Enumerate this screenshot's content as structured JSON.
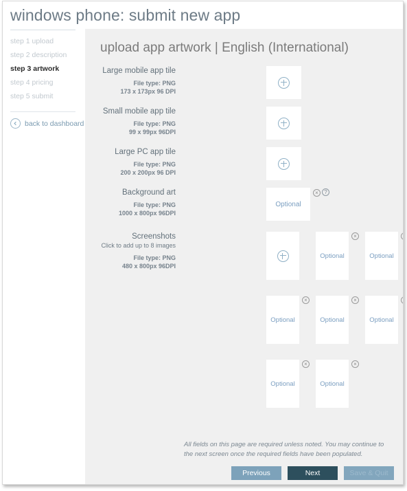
{
  "window": {
    "title": "windows phone: submit new app"
  },
  "sidebar": {
    "steps": [
      {
        "label": "step 1 upload",
        "active": false
      },
      {
        "label": "step 2 description",
        "active": false
      },
      {
        "label": "step 3 artwork",
        "active": true
      },
      {
        "label": "step 4 pricing",
        "active": false
      },
      {
        "label": "step 5 submit",
        "active": false
      }
    ],
    "back_link": {
      "label": "back to dashboard",
      "icon": "back-arrow-circle-icon"
    }
  },
  "main": {
    "heading": "upload app artwork | English (International)",
    "rows": [
      {
        "id": "large-mobile-app-tile",
        "title": "Large mobile app tile",
        "filetype": "File type: PNG",
        "dimensions": "173 x 173px 96 DPI",
        "tile_state": "add",
        "tile_label": ""
      },
      {
        "id": "small-mobile-app-tile",
        "title": "Small mobile app tile",
        "filetype": "File type: PNG",
        "dimensions": "99 x 99px 96DPI",
        "tile_state": "add",
        "tile_label": ""
      },
      {
        "id": "large-pc-app-tile",
        "title": "Large PC app tile",
        "filetype": "File type: PNG",
        "dimensions": "200 x 200px 96 DPI",
        "tile_state": "add",
        "tile_label": ""
      },
      {
        "id": "background-art",
        "title": "Background art",
        "filetype": "File type: PNG",
        "dimensions": "1000 x 800px 96DPI",
        "tile_state": "optional",
        "tile_label": "Optional"
      }
    ],
    "screenshots": {
      "title": "Screenshots",
      "hint": "Click to add up to 8 images",
      "filetype": "File type: PNG",
      "dimensions": "480 x 800px 96DPI",
      "tiles": [
        {
          "state": "add",
          "label": "",
          "remove": false
        },
        {
          "state": "optional",
          "label": "Optional",
          "remove": true
        },
        {
          "state": "optional",
          "label": "Optional",
          "remove": true
        },
        {
          "state": "optional",
          "label": "Optional",
          "remove": true
        },
        {
          "state": "optional",
          "label": "Optional",
          "remove": true
        },
        {
          "state": "optional",
          "label": "Optional",
          "remove": true
        },
        {
          "state": "optional",
          "label": "Optional",
          "remove": true
        },
        {
          "state": "optional",
          "label": "Optional",
          "remove": true
        }
      ]
    },
    "footnote": "All fields on this page are required unless noted. You may continue to the next screen once the required fields have been populated."
  },
  "footer": {
    "buttons": [
      {
        "id": "previous",
        "label": "Previous",
        "style": "prev",
        "disabled": false
      },
      {
        "id": "next",
        "label": "Next",
        "style": "next",
        "disabled": false
      },
      {
        "id": "save-quit",
        "label": "Save & Quit",
        "style": "quit",
        "disabled": true
      }
    ]
  },
  "icons": {
    "remove": "×",
    "help": "?"
  },
  "colors": {
    "panel_bg": "#f0f0f0",
    "accent_blue": "#7a9ec0",
    "btn_primary": "#2d4f5d",
    "btn_secondary": "#7da2ba",
    "title_text": "#6d7b86"
  }
}
